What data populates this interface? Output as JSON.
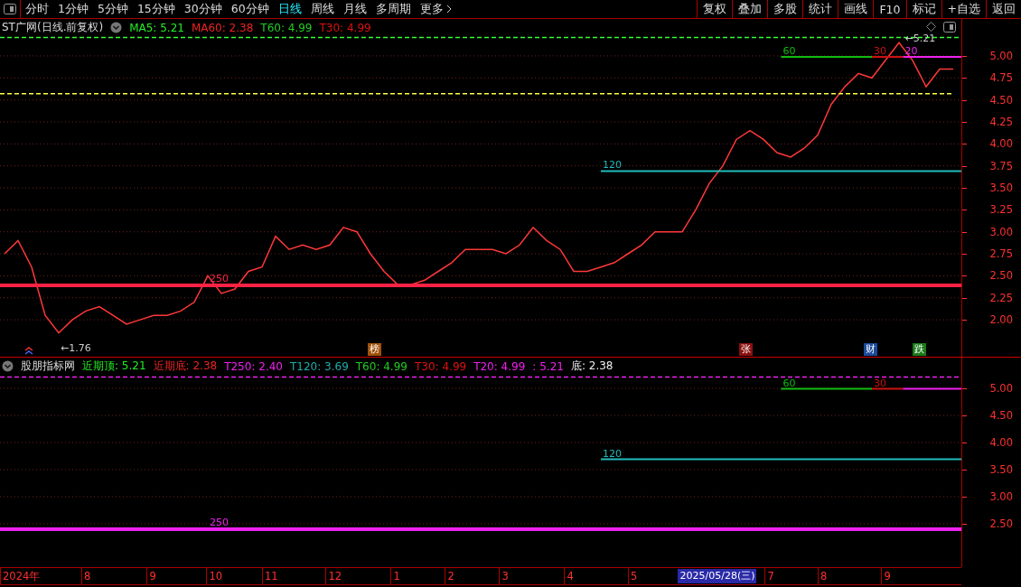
{
  "toolbar": {
    "periods": [
      {
        "label": "分时",
        "selected": false
      },
      {
        "label": "1分钟",
        "selected": false
      },
      {
        "label": "5分钟",
        "selected": false
      },
      {
        "label": "15分钟",
        "selected": false
      },
      {
        "label": "30分钟",
        "selected": false
      },
      {
        "label": "60分钟",
        "selected": false
      },
      {
        "label": "日线",
        "selected": true
      },
      {
        "label": "周线",
        "selected": false
      },
      {
        "label": "月线",
        "selected": false
      },
      {
        "label": "多周期",
        "selected": false
      },
      {
        "label": "更多",
        "selected": false
      }
    ],
    "tools": [
      "复权",
      "叠加",
      "多股",
      "统计",
      "画线",
      "F10",
      "标记",
      "+自选",
      "返回"
    ]
  },
  "main": {
    "legend": {
      "title": "ST广网(日线.前复权)",
      "items": [
        {
          "text": "MA5: 5.21",
          "color": "#22ee22"
        },
        {
          "text": "MA60: 2.38",
          "color": "#ee2222"
        },
        {
          "text": "T60: 4.99",
          "color": "#22cc22"
        },
        {
          "text": "T30: 4.99",
          "color": "#dd1111"
        }
      ]
    },
    "axis_labels": [
      "5.00",
      "4.75",
      "4.50",
      "4.25",
      "4.00",
      "3.75",
      "3.50",
      "3.25",
      "3.00",
      "2.75",
      "2.50",
      "2.25",
      "2.00"
    ],
    "annotations": [
      "←1.76",
      "←5.21"
    ],
    "level_labels": [
      "60",
      "30",
      "20",
      "120",
      "250"
    ],
    "events": [
      {
        "text": "榜",
        "color": "#a0520a"
      },
      {
        "text": "张",
        "color": "#8a1010"
      },
      {
        "text": "财",
        "color": "#1a4a9a"
      },
      {
        "text": "跌",
        "color": "#1a7a1a"
      }
    ]
  },
  "indicator": {
    "legend": {
      "title": "股朋指标网",
      "items": [
        {
          "text": "近期顶: 5.21",
          "color": "#22ee22"
        },
        {
          "text": "近期底: 2.38",
          "color": "#ee2222"
        },
        {
          "text": "T250: 2.40",
          "color": "#ee22ee"
        },
        {
          "text": "T120: 3.69",
          "color": "#22aaaa"
        },
        {
          "text": "T60: 4.99",
          "color": "#22cc22"
        },
        {
          "text": "T30: 4.99",
          "color": "#dd1111"
        },
        {
          "text": "T20: 4.99",
          "color": "#ee22ee"
        },
        {
          "text": ": 5.21",
          "color": "#ee22ee"
        },
        {
          "text": "底: 2.38",
          "color": "#eeeeee"
        }
      ]
    },
    "axis_labels": [
      "5.00",
      "4.50",
      "4.00",
      "3.50",
      "3.00",
      "2.50"
    ],
    "level_labels": [
      "60",
      "30",
      "120",
      "250"
    ]
  },
  "date_axis": {
    "labels": [
      "2024年",
      "8",
      "9",
      "10",
      "11",
      "12",
      "1",
      "2",
      "3",
      "4",
      "5",
      "7",
      "8",
      "9"
    ],
    "cursor": "2025/05/28(三)"
  }
}
